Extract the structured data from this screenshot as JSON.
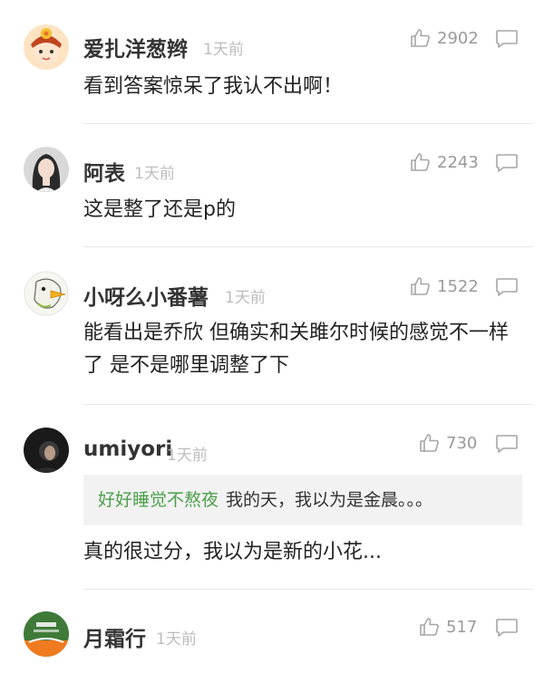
{
  "comments": [
    {
      "username": "爱扎洋葱辫",
      "time": "1天前",
      "likes": "2902",
      "text": "看到答案惊呆了我认不出啊！"
    },
    {
      "username": "阿表",
      "time": "1天前",
      "likes": "2243",
      "text": "这是整了还是p的"
    },
    {
      "username": "小呀么小番薯",
      "time": "1天前",
      "likes": "1522",
      "text": "能看出是乔欣 但确实和关雎尔时候的感觉不一样了 是不是哪里调整了下"
    },
    {
      "username": "umiyori",
      "time": "1天前",
      "likes": "730",
      "quote_user": "好好睡觉不熬夜",
      "quote_text": "我的天，我以为是金晨。。。",
      "text": "真的很过分，我以为是新的小花..."
    },
    {
      "username": "月霜行",
      "time": "1天前",
      "likes": "517"
    }
  ],
  "icons": {
    "like": "thumbs-up-icon",
    "reply": "comment-bubble-icon"
  },
  "colors": {
    "quote_user": "#4aa04a",
    "meta_gray": "#9a9a9a"
  }
}
